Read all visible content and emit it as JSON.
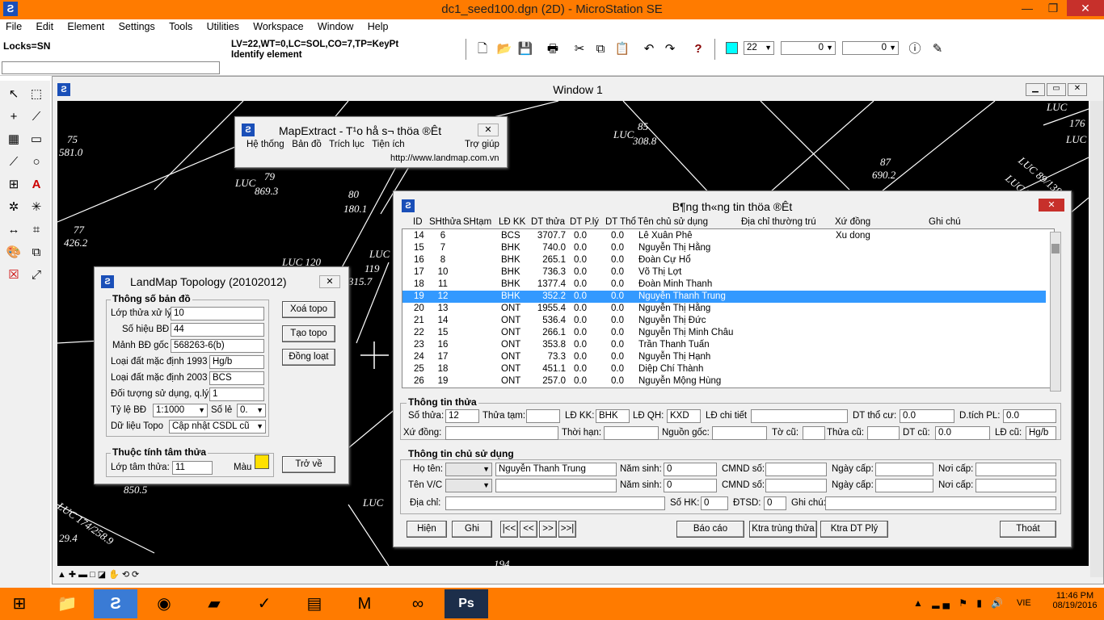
{
  "app": {
    "title": "dc1_seed100.dgn (2D) - MicroStation SE",
    "min": "—",
    "max": "❐",
    "close": "✕"
  },
  "menu": [
    "File",
    "Edit",
    "Element",
    "Settings",
    "Tools",
    "Utilities",
    "Workspace",
    "Window",
    "Help"
  ],
  "status": {
    "locks": "Locks=SN",
    "line1": "LV=22,WT=0,LC=SOL,CO=7,TP=KeyPt",
    "line2": "Identify element"
  },
  "toolbar": {
    "level": "22",
    "weight": "0",
    "style": "0"
  },
  "window1": {
    "title": "Window 1"
  },
  "cad_labels": [
    "75",
    "581.0",
    "LUC",
    "79",
    "869.3",
    "80",
    "180.1",
    "77",
    "426.2",
    "LUC",
    "85",
    "308.8",
    "87",
    "690.2",
    "LUC 89/138.7",
    "LUC 86/151",
    "119",
    "315.7",
    "LUC 120",
    "LUC",
    "850.5",
    "LUC 174/258.9",
    "29.4",
    "LUC",
    "194",
    "LUC",
    "176",
    "LUC"
  ],
  "mapextract": {
    "title": "MapExtract - T¹o hå s¬ thöa ®Êt",
    "menu": [
      "Hệ thống",
      "Bản đồ",
      "Trích lục",
      "Tiện ích"
    ],
    "help": "Trợ giúp",
    "url": "http://www.landmap.com.vn"
  },
  "topology": {
    "title": "LandMap Topology (20102012)",
    "group1": "Thông số bản đồ",
    "labels": {
      "lop_thua": "Lớp thửa xử lý",
      "so_hieu": "Số hiệu BĐ",
      "manh_bd": "Mảnh BĐ gốc",
      "ld1993": "Loại đất mặc định 1993",
      "ld2003": "Loại đất mặc định 2003",
      "doi_tuong": "Đối tượng sử dụng, q.lý",
      "ty_le": "Tỷ lệ BĐ",
      "so_le": "Số lẻ",
      "du_lieu": "Dữ liệu Topo"
    },
    "values": {
      "lop_thua": "10",
      "so_hieu": "44",
      "manh_bd": "568263-6(b)",
      "ld1993": "Hg/b",
      "ld2003": "BCS",
      "doi_tuong": "1",
      "ty_le": "1:1000",
      "so_le": "0.",
      "du_lieu": "Cập nhật CSDL cũ"
    },
    "group2": "Thuộc tính tâm thửa",
    "lop_tam_label": "Lớp tâm thửa:",
    "lop_tam": "11",
    "mau_label": "Màu",
    "buttons": {
      "xoa": "Xoá topo",
      "tao": "Tạo topo",
      "dong": "Đồng loạt",
      "tro": "Trở về"
    }
  },
  "parcel": {
    "title": "B¶ng th«ng tin thöa ®Êt",
    "headers": [
      "ID",
      "SHthửa",
      "SHtạm",
      "LĐ KK",
      "DT thửa",
      "DT P.lý",
      "DT Thổ",
      "Tên chủ sử dụng",
      "Địa chỉ thường trú",
      "Xứ đồng",
      "Ghi chú"
    ],
    "rows": [
      [
        "14",
        "6",
        "",
        "BCS",
        "3707.7",
        "0.0",
        "0.0",
        "Lê Xuân Phê",
        "",
        "Xu dong",
        ""
      ],
      [
        "15",
        "7",
        "",
        "BHK",
        "740.0",
        "0.0",
        "0.0",
        "Nguyễn Thị Hằng",
        "",
        "",
        ""
      ],
      [
        "16",
        "8",
        "",
        "BHK",
        "265.1",
        "0.0",
        "0.0",
        "Đoàn Cự Hổ",
        "",
        "",
        ""
      ],
      [
        "17",
        "10",
        "",
        "BHK",
        "736.3",
        "0.0",
        "0.0",
        "Võ Thị Lợt",
        "",
        "",
        ""
      ],
      [
        "18",
        "11",
        "",
        "BHK",
        "1377.4",
        "0.0",
        "0.0",
        "Đoàn Minh Thanh",
        "",
        "",
        ""
      ],
      [
        "19",
        "12",
        "",
        "BHK",
        "352.2",
        "0.0",
        "0.0",
        "Nguyễn Thanh Trung",
        "",
        "",
        ""
      ],
      [
        "20",
        "13",
        "",
        "ONT",
        "1955.4",
        "0.0",
        "0.0",
        "Nguyễn Thị Hằng",
        "",
        "",
        ""
      ],
      [
        "21",
        "14",
        "",
        "ONT",
        "536.4",
        "0.0",
        "0.0",
        "Nguyễn Thị Đức",
        "",
        "",
        ""
      ],
      [
        "22",
        "15",
        "",
        "ONT",
        "266.1",
        "0.0",
        "0.0",
        "Nguyễn Thị Minh Châu",
        "",
        "",
        ""
      ],
      [
        "23",
        "16",
        "",
        "ONT",
        "353.8",
        "0.0",
        "0.0",
        "Trần Thanh Tuấn",
        "",
        "",
        ""
      ],
      [
        "24",
        "17",
        "",
        "ONT",
        "73.3",
        "0.0",
        "0.0",
        "Nguyễn Thị Hạnh",
        "",
        "",
        ""
      ],
      [
        "25",
        "18",
        "",
        "ONT",
        "451.1",
        "0.0",
        "0.0",
        "Diệp Chí Thành",
        "",
        "",
        ""
      ],
      [
        "26",
        "19",
        "",
        "ONT",
        "257.0",
        "0.0",
        "0.0",
        "Nguyễn Mộng Hùng",
        "",
        "",
        ""
      ]
    ],
    "selected_index": 5,
    "info_title": "Thông tin thửa",
    "info": {
      "so_thua_l": "Số thửa:",
      "so_thua": "12",
      "thua_tam_l": "Thửa tạm:",
      "thua_tam": "",
      "ld_kk_l": "LĐ KK:",
      "ld_kk": "BHK",
      "ld_qh_l": "LĐ QH:",
      "ld_qh": "KXD",
      "ld_ct_l": "LĐ chi tiết",
      "ld_ct": "",
      "dt_tho_l": "DT thổ cư:",
      "dt_tho": "0.0",
      "dtich_l": "D.tích PL:",
      "dtich": "0.0",
      "xu_dong_l": "Xứ đồng:",
      "xu_dong": "",
      "thoi_han_l": "Thời hạn:",
      "thoi_han": "",
      "nguon_goc_l": "Nguồn gốc:",
      "nguon_goc": "",
      "to_cu_l": "Tờ cũ:",
      "to_cu": "",
      "thua_cu_l": "Thửa cũ:",
      "thua_cu": "",
      "dt_cu_l": "DT cũ:",
      "dt_cu": "0.0",
      "ld_cu_l": "LĐ cũ:",
      "ld_cu": "Hg/b"
    },
    "owner_title": "Thông tin chủ sử dụng",
    "owner": {
      "ho_ten_l": "Họ tên:",
      "ho_ten": "Nguyễn Thanh Trung",
      "ten_vc_l": "Tên V/C",
      "ten_vc": "",
      "nam_sinh_l": "Năm sinh:",
      "nam_sinh1": "0",
      "nam_sinh2": "0",
      "cmnd_l": "CMND số:",
      "ngay_cap_l": "Ngày cấp:",
      "noi_cap_l": "Nơi cấp:",
      "dia_chi_l": "Địa chỉ:",
      "so_hk_l": "Số HK:",
      "so_hk": "0",
      "dtsd_l": "ĐTSD:",
      "dtsd": "0",
      "ghi_chu_l": "Ghi chú:"
    },
    "buttons": {
      "hien": "Hiện",
      "ghi": "Ghi",
      "first": "|<<",
      "prev": "<<",
      "next": ">>",
      "last": ">>|",
      "bao_cao": "Báo cáo",
      "ktra_trung": "Ktra trùng thửa",
      "ktra_dt": "Ktra DT Plý",
      "thoat": "Thoát"
    }
  },
  "tray": {
    "lang": "VIE",
    "time": "11:46 PM",
    "date": "08/19/2016"
  }
}
